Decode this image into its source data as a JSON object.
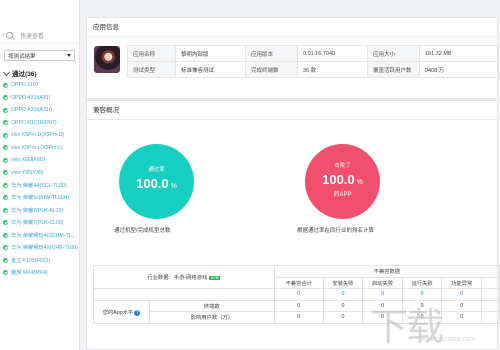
{
  "sidebar": {
    "search_label": "快速查看",
    "filter_value": "按测试结果",
    "group_label": "通过(36)",
    "items": [
      "OPPO 1107",
      "OPPO A31t(A31)",
      "OPPO A31t(A31t)",
      "OPPO R1C(R8207)",
      "vivo X5Pro D(X5Pro D)",
      "vivo X5Pro L(X5Pro L)",
      "vivo X6D(X6D)",
      "vivo Y35(Y35)",
      "华为 荣耀4A(SCL-TL00)",
      "华为 荣耀5x(KIW-TL00H)",
      "华为 荣耀7(PLK-AL10)",
      "华为 荣耀7(PLK-CL00)",
      "华为 荣耀畅玩4C(CHM-TL...",
      "华为 荣耀畅玩4X(CHE-TL00)",
      "金立 F103(F103)",
      "魅族 MX4(MX4)"
    ]
  },
  "app_info": {
    "title": "应用信息",
    "rows": [
      [
        "应用名称",
        "黎明内部版",
        "应用版本",
        "0.01.16.7040",
        "应用大小",
        "191.32 MB"
      ],
      [
        "测试类型",
        "标准兼容测试",
        "完成终端数",
        "36 款",
        "覆盖活跃用户数",
        "9408 万"
      ]
    ]
  },
  "compat": {
    "title": "兼容概况",
    "pass_label": "通过率",
    "pass_value": "100.0",
    "pass_unit": "%",
    "pass_caption": "通过机型/完成机型总数",
    "beat_label": "击败了",
    "beat_value": "100.0",
    "beat_unit": "%",
    "beat_sub": "的APP",
    "beat_caption": "根据通过率在同行业的排名计算"
  },
  "stats": {
    "industry_label": "行业数据：手游-网络游戏",
    "badge": "NEW",
    "incompat_header": "不兼容数据",
    "columns": [
      "不兼容合计",
      "安装失败",
      "启动失败",
      "运行失败",
      "功能异常"
    ],
    "level_label": "您的App水平",
    "rows": [
      {
        "name": "终端数",
        "values": [
          "0",
          "0",
          "0",
          "0",
          "0"
        ]
      },
      {
        "name": "影响用户数（万）",
        "values": [
          "0",
          "0",
          "0",
          "0",
          "0"
        ]
      }
    ]
  },
  "watermark": {
    "text": "下载",
    "url": "www.xiazaiba.com"
  }
}
